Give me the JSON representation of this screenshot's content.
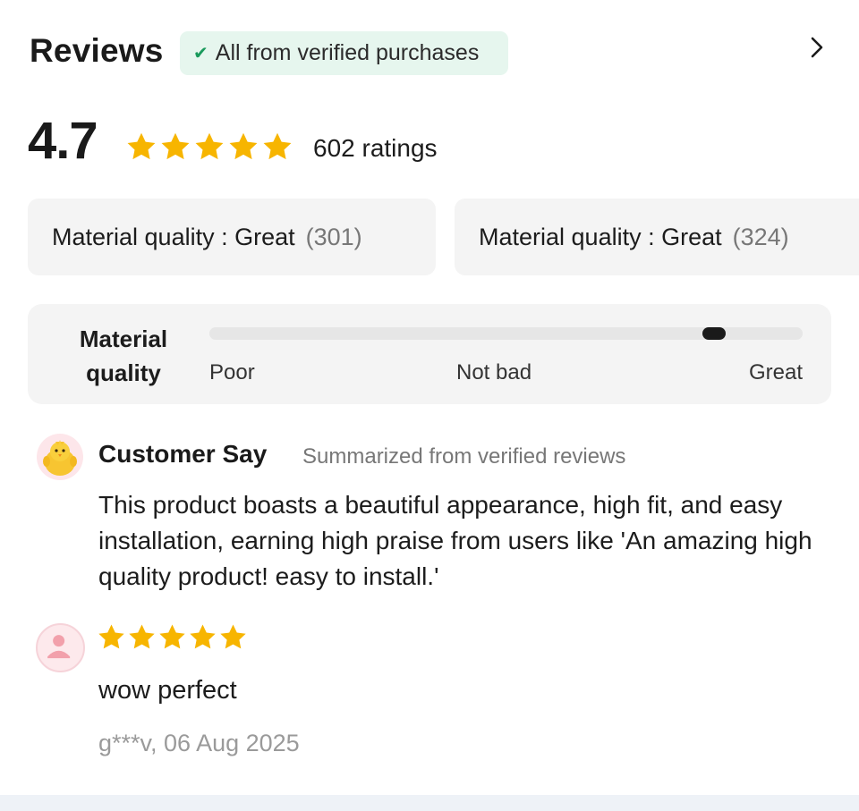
{
  "header": {
    "title": "Reviews",
    "verified_badge": "All from verified purchases",
    "check_icon": "check-icon",
    "chevron_icon": "chevron-right-icon"
  },
  "summary": {
    "average": "4.7",
    "stars": 5,
    "ratings_count": "602 ratings",
    "star_color": "#f7b500"
  },
  "tags": [
    {
      "label": "Material quality : Great",
      "count": "(301)"
    },
    {
      "label": "Material quality : Great",
      "count": "(324)"
    }
  ],
  "quality_scale": {
    "label": "Material quality",
    "ticks": [
      "Poor",
      "Not bad",
      "Great"
    ],
    "level": 0.85
  },
  "customer_say": {
    "title": "Customer Say",
    "subtitle": "Summarized from verified reviews",
    "text": "This product boasts a beautiful appearance, high fit, and easy installation, earning high praise from users like 'An amazing high quality product! easy to install.'"
  },
  "review": {
    "stars": 5,
    "text": "wow perfect",
    "meta": "g***v, 06 Aug 2025"
  }
}
